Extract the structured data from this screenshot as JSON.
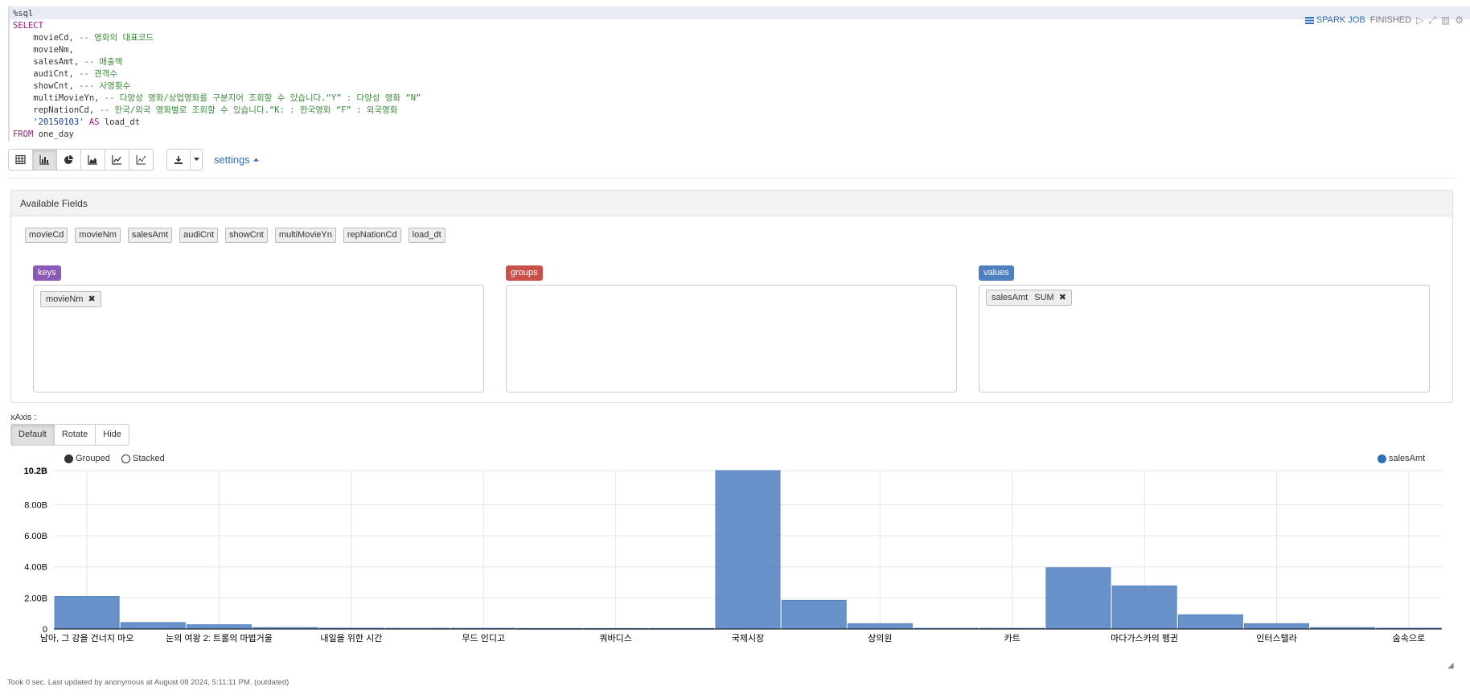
{
  "paragraph": {
    "code_lines": [
      [
        {
          "t": "%sql",
          "c": ""
        }
      ],
      [
        {
          "t": "SELECT",
          "c": "kw"
        }
      ],
      [
        {
          "t": "    movieCd, ",
          "c": ""
        },
        {
          "t": "-- 영화의 대표코드",
          "c": "cm"
        }
      ],
      [
        {
          "t": "    movieNm,",
          "c": ""
        }
      ],
      [
        {
          "t": "    salesAmt, ",
          "c": ""
        },
        {
          "t": "-- 매출액",
          "c": "cm"
        }
      ],
      [
        {
          "t": "    audiCnt, ",
          "c": ""
        },
        {
          "t": "-- 관객수",
          "c": "cm"
        }
      ],
      [
        {
          "t": "    showCnt, ",
          "c": ""
        },
        {
          "t": "--- 사영횟수",
          "c": "cm"
        }
      ],
      [
        {
          "t": "    multiMovieYn, ",
          "c": ""
        },
        {
          "t": "-- 다양성 영화/상업영화를 구분지어 조회할 수 있습니다.“Y” : 다양성 영화 “N”",
          "c": "cm"
        }
      ],
      [
        {
          "t": "    repNationCd, ",
          "c": ""
        },
        {
          "t": "-- 한국/외국 영화별로 조회할 수 있습니다.“K: : 한국영화 “F” : 외국영화",
          "c": "cm"
        }
      ],
      [
        {
          "t": "    ",
          "c": ""
        },
        {
          "t": "'20150103'",
          "c": "st"
        },
        {
          "t": " ",
          "c": ""
        },
        {
          "t": "AS",
          "c": "kw"
        },
        {
          "t": " load_dt",
          "c": ""
        }
      ],
      [
        {
          "t": "FROM",
          "c": "kw"
        },
        {
          "t": " one_day",
          "c": ""
        }
      ]
    ],
    "status": {
      "spark_job": "SPARK JOB",
      "state": "FINISHED"
    }
  },
  "toolbar": {
    "viz_buttons": [
      "table-icon",
      "bar-chart-icon",
      "pie-chart-icon",
      "area-chart-icon",
      "line-chart-icon",
      "scatter-chart-icon"
    ],
    "active_viz": "bar-chart-icon",
    "settings_label": "settings"
  },
  "pivot": {
    "title": "Available Fields",
    "fields": [
      "movieCd",
      "movieNm",
      "salesAmt",
      "audiCnt",
      "showCnt",
      "multiMovieYn",
      "repNationCd",
      "load_dt"
    ],
    "keys_label": "keys",
    "groups_label": "groups",
    "values_label": "values",
    "keys": [
      "movieNm"
    ],
    "groups": [],
    "values": [
      {
        "field": "salesAmt",
        "agg": "SUM"
      }
    ]
  },
  "xaxis": {
    "label": "xAxis :",
    "options": [
      "Default",
      "Rotate",
      "Hide"
    ],
    "active": "Default"
  },
  "chart_toggle": {
    "grouped": "Grouped",
    "stacked": "Stacked",
    "selected": "Grouped"
  },
  "chart_data": {
    "type": "bar",
    "series": [
      {
        "name": "salesAmt",
        "color": "#4f7ec1",
        "values": [
          2.1,
          0.42,
          0.28,
          0.1,
          0.06,
          0.05,
          0.05,
          0.04,
          0.04,
          0.04,
          10.2,
          1.85,
          0.35,
          0.05,
          0.05,
          3.95,
          2.78,
          0.92,
          0.35,
          0.1,
          0.06
        ]
      }
    ],
    "categories": [
      "남아, 그 강을 건너지 마오",
      "",
      "눈의 여왕 2: 트롤의 마법거울",
      "",
      "내일을 위한 시간",
      "",
      "무드 인디고",
      "",
      "쿼바디스",
      "",
      "국제시장",
      "",
      "상의원",
      "",
      "카트",
      "",
      "마다가스카의 펭귄",
      "",
      "인터스텔라",
      "",
      "숨속으로"
    ],
    "y_ticks": [
      "0",
      "2.00B",
      "4.00B",
      "6.00B",
      "8.00B",
      "10.2B"
    ],
    "ylim": [
      0,
      10.2
    ],
    "grid": true,
    "legend_position": "top-right"
  },
  "footer": "Took 0 sec. Last updated by anonymous at August 08 2024, 5:11:11 PM. (outdated)"
}
